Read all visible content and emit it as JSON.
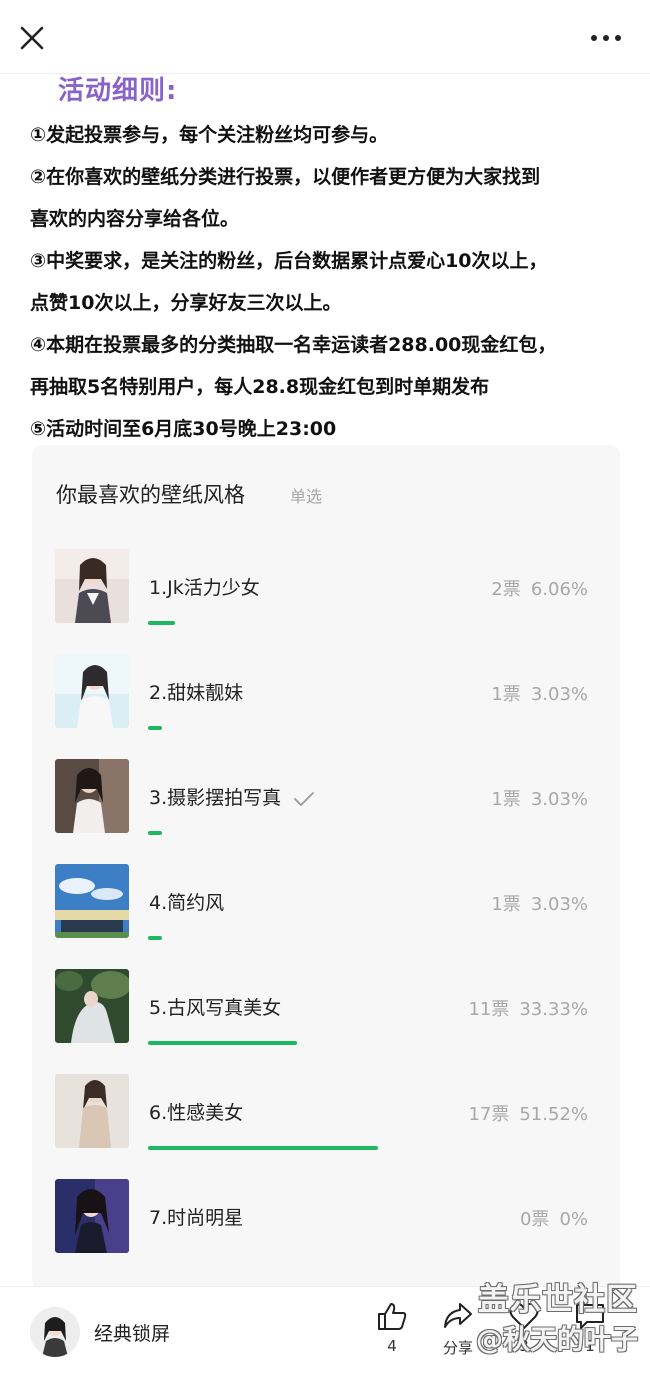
{
  "header": {
    "close_icon": "close-icon",
    "more_icon": "more-dots-icon"
  },
  "article": {
    "section_title": "活动细则:",
    "rules": [
      "①发起投票参与，每个关注粉丝均可参与。",
      "②在你喜欢的壁纸分类进行投票，以便作者更方便为大家找到",
      "喜欢的内容分享给各位。",
      "③中奖要求，是关注的粉丝，后台数据累计点爱心10次以上，",
      "点赞10次以上，分享好友三次以上。",
      "④本期在投票最多的分类抽取一名幸运读者288.00现金红包，",
      "再抽取5名特别用户，每人28.8现金红包到时单期发布",
      "⑤活动时间至6月底30号晚上23:00"
    ]
  },
  "vote": {
    "title": "你最喜欢的壁纸风格",
    "type": "单选",
    "accent_color": "#1fb862",
    "options": [
      {
        "label": "1.Jk活力少女",
        "votes": "2票",
        "percent": "6.06%",
        "fraction": 0.0606,
        "selected": false
      },
      {
        "label": "2.甜妹靓妹",
        "votes": "1票",
        "percent": "3.03%",
        "fraction": 0.0303,
        "selected": false
      },
      {
        "label": "3.摄影摆拍写真",
        "votes": "1票",
        "percent": "3.03%",
        "fraction": 0.0303,
        "selected": true
      },
      {
        "label": "4.简约风",
        "votes": "1票",
        "percent": "3.03%",
        "fraction": 0.0303,
        "selected": false
      },
      {
        "label": "5.古风写真美女",
        "votes": "11票",
        "percent": "33.33%",
        "fraction": 0.3333,
        "selected": false
      },
      {
        "label": "6.性感美女",
        "votes": "17票",
        "percent": "51.52%",
        "fraction": 0.5152,
        "selected": false
      },
      {
        "label": "7.时尚明星",
        "votes": "0票",
        "percent": "0%",
        "fraction": 0,
        "selected": false
      }
    ]
  },
  "footer": {
    "account_name": "经典锁屏",
    "like_count": "4",
    "share_label": "分享",
    "heart_count": "3",
    "comment_count": "1"
  },
  "watermark": {
    "line1": "盖乐世社区",
    "line2": "@秋天的叶子"
  }
}
